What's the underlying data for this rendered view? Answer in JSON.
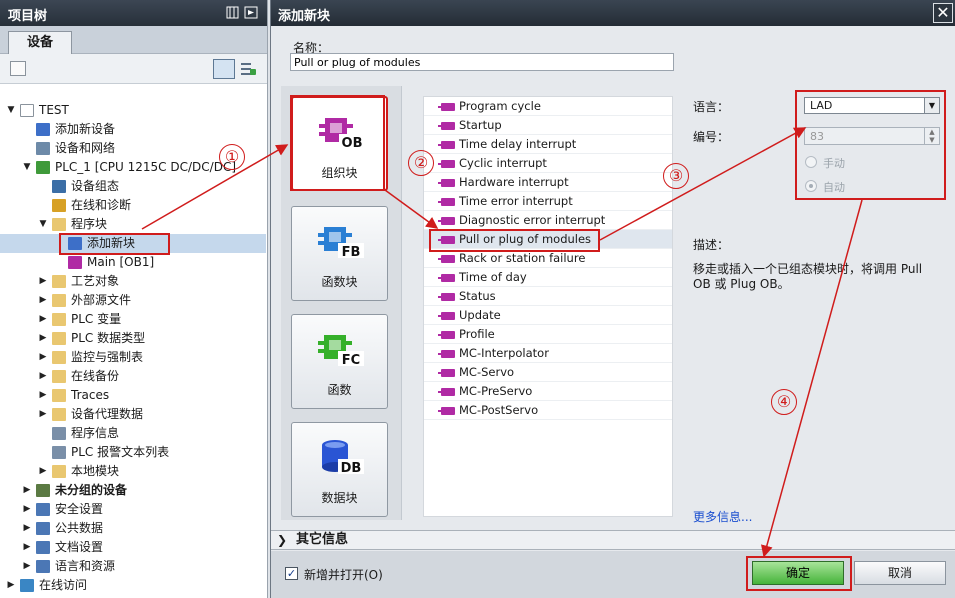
{
  "tree": {
    "title": "项目树",
    "tab_label": "设备",
    "items": [
      {
        "label": "TEST",
        "arrow": "▼",
        "icon_color": "#ffffff",
        "icon": "project-icon"
      },
      {
        "label": "添加新设备",
        "arrow": "",
        "icon_color": "#3d6fc8",
        "icon": "add-device-icon"
      },
      {
        "label": "设备和网络",
        "arrow": "",
        "icon_color": "#6d8aa8",
        "icon": "network-icon"
      },
      {
        "label": "PLC_1 [CPU 1215C DC/DC/DC]",
        "arrow": "▼",
        "icon_color": "#3f9a3a",
        "icon": "plc-icon"
      },
      {
        "label": "设备组态",
        "arrow": "",
        "icon_color": "#3b6ea6",
        "icon": "device-config-icon"
      },
      {
        "label": "在线和诊断",
        "arrow": "",
        "icon_color": "#d7a126",
        "icon": "online-diagnostics-icon"
      },
      {
        "label": "程序块",
        "arrow": "▼",
        "icon_color": "#e9c770",
        "icon": "folder-icon"
      },
      {
        "label": "添加新块",
        "arrow": "",
        "icon_color": "#3d6fc8",
        "icon": "add-block-icon"
      },
      {
        "label": "Main [OB1]",
        "arrow": "",
        "icon_color": "#b02aa4",
        "icon": "ob-icon"
      },
      {
        "label": "工艺对象",
        "arrow": "▶",
        "icon_color": "#e9c770",
        "icon": "folder-icon"
      },
      {
        "label": "外部源文件",
        "arrow": "▶",
        "icon_color": "#e9c770",
        "icon": "folder-icon"
      },
      {
        "label": "PLC 变量",
        "arrow": "▶",
        "icon_color": "#e9c770",
        "icon": "folder-icon"
      },
      {
        "label": "PLC 数据类型",
        "arrow": "▶",
        "icon_color": "#e9c770",
        "icon": "folder-icon"
      },
      {
        "label": "监控与强制表",
        "arrow": "▶",
        "icon_color": "#e9c770",
        "icon": "folder-icon"
      },
      {
        "label": "在线备份",
        "arrow": "▶",
        "icon_color": "#e9c770",
        "icon": "folder-icon"
      },
      {
        "label": "Traces",
        "arrow": "▶",
        "icon_color": "#e9c770",
        "icon": "folder-icon"
      },
      {
        "label": "设备代理数据",
        "arrow": "▶",
        "icon_color": "#e9c770",
        "icon": "folder-icon"
      },
      {
        "label": "程序信息",
        "arrow": "",
        "icon_color": "#7a8fa8",
        "icon": "program-info-icon"
      },
      {
        "label": "PLC 报警文本列表",
        "arrow": "",
        "icon_color": "#7a8fa8",
        "icon": "alarm-text-icon"
      },
      {
        "label": "本地模块",
        "arrow": "▶",
        "icon_color": "#e9c770",
        "icon": "folder-icon"
      },
      {
        "label": "未分组的设备",
        "arrow": "▶",
        "icon_color": "#5b7a43",
        "icon": "ungrouped-devices-icon",
        "bold": true
      },
      {
        "label": "安全设置",
        "arrow": "▶",
        "icon_color": "#4b77b5",
        "icon": "security-icon"
      },
      {
        "label": "公共数据",
        "arrow": "▶",
        "icon_color": "#4b77b5",
        "icon": "common-data-icon"
      },
      {
        "label": "文档设置",
        "arrow": "▶",
        "icon_color": "#4b77b5",
        "icon": "documentation-icon"
      },
      {
        "label": "语言和资源",
        "arrow": "▶",
        "icon_color": "#4b77b5",
        "icon": "languages-icon"
      },
      {
        "label": "在线访问",
        "arrow": "▶",
        "icon_color": "#3a86c4",
        "icon": "online-access-icon"
      }
    ]
  },
  "dialog": {
    "title": "添加新块",
    "close": "✕",
    "name_label": "名称：",
    "name_value": "Pull or plug of modules",
    "block_types": [
      {
        "code": "OB",
        "label": "组织块",
        "color": "#b02aa4"
      },
      {
        "code": "FB",
        "label": "函数块",
        "color": "#2a7fd4"
      },
      {
        "code": "FC",
        "label": "函数",
        "color": "#35b02a"
      },
      {
        "code": "DB",
        "label": "数据块",
        "color": "#2a55d4"
      }
    ],
    "ob_list": [
      "Program cycle",
      "Startup",
      "Time delay interrupt",
      "Cyclic interrupt",
      "Hardware interrupt",
      "Time error interrupt",
      "Diagnostic error interrupt",
      "Pull or plug of modules",
      "Rack or station failure",
      "Time of day",
      "Status",
      "Update",
      "Profile",
      "MC-Interpolator",
      "MC-Servo",
      "MC-PreServo",
      "MC-PostServo"
    ],
    "language_label": "语言：",
    "language_value": "LAD",
    "number_label": "编号：",
    "number_value": "83",
    "manual_label": "手动",
    "auto_label": "自动",
    "description_label": "描述：",
    "description_text": "移走或插入一个已组态模块时，将调用 Pull OB 或 Plug OB。",
    "more_info": "更多信息...",
    "other_info": "其它信息",
    "open_checkbox_label": "新增并打开(O)",
    "ok": "确定",
    "cancel": "取消"
  },
  "annotations": [
    "①",
    "②",
    "③",
    "④"
  ],
  "colors": {
    "annotation": "#d01c1c",
    "ok_button": "#46b33a"
  }
}
